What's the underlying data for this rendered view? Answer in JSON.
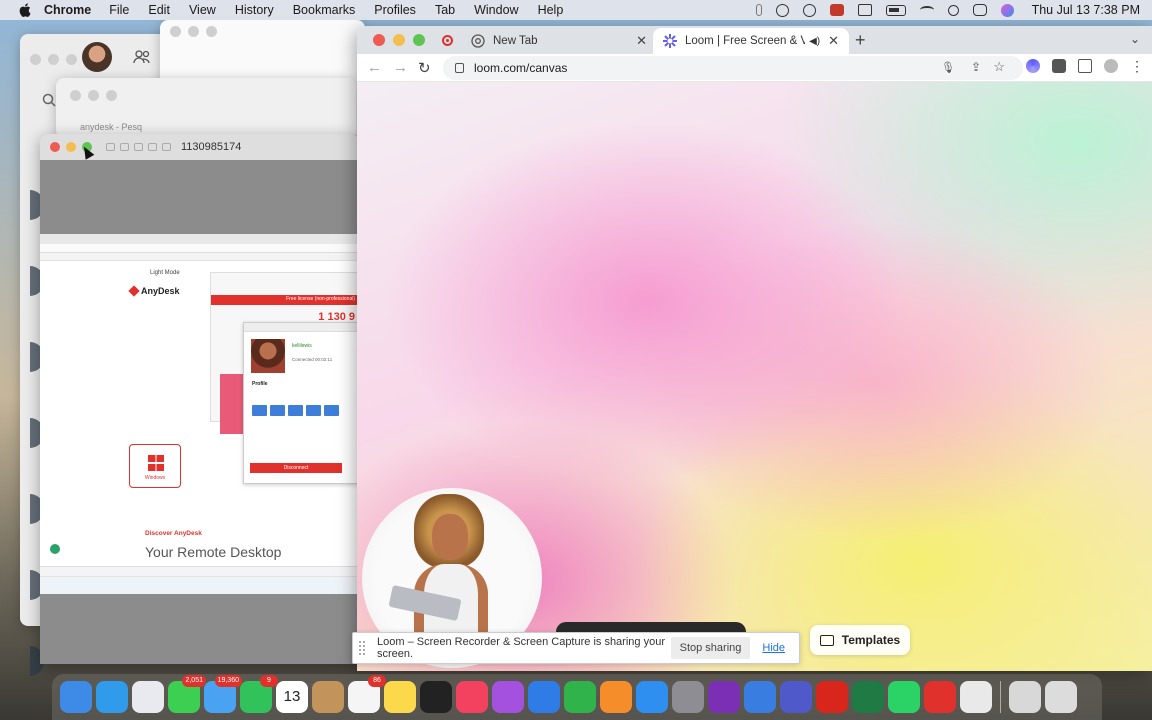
{
  "menubar": {
    "app_name": "Chrome",
    "items": [
      "File",
      "Edit",
      "View",
      "History",
      "Bookmarks",
      "Profiles",
      "Tab",
      "Window",
      "Help"
    ],
    "clock": "Thu Jul 13  7:38 PM"
  },
  "background_windows": {
    "anydesk_tab_text": "anydesk - Pesq"
  },
  "anydesk_window": {
    "title": "1130985174",
    "remote": {
      "mode_label": "Light Mode",
      "logo_text": "AnyDesk",
      "windows_label": "Windows",
      "discover_text": "Discover AnyDesk",
      "headline": "Your Remote Desktop",
      "license_banner": "Free license (non-professional)",
      "big_id": "1 130 9",
      "profile_name": "kellilewis",
      "connected_text": "Connected 00:02:11",
      "profile_heading": "Profile",
      "disconnect_label": "Disconnect"
    }
  },
  "chrome": {
    "tabs": [
      {
        "label": "New Tab",
        "icon": "chrome-icon",
        "active": false
      },
      {
        "label": "Loom | Free Screen & Vide",
        "icon": "loom-icon",
        "active": true,
        "audio": true
      }
    ],
    "url": "loom.com/canvas",
    "templates_label": "Templates",
    "share_banner": {
      "message": "Loom – Screen Recorder & Screen Capture is sharing your screen.",
      "stop_label": "Stop sharing",
      "hide_label": "Hide"
    }
  },
  "dock": {
    "apps": [
      {
        "name": "finder",
        "color": "#3d8be6"
      },
      {
        "name": "safari",
        "color": "#2f9bea"
      },
      {
        "name": "launchpad",
        "color": "#e8eaef"
      },
      {
        "name": "messages",
        "color": "#3ccf52",
        "badge": "2,051"
      },
      {
        "name": "mail",
        "color": "#4aa3f2",
        "badge": "19,360"
      },
      {
        "name": "facetime",
        "color": "#31c25b",
        "badge": "9"
      },
      {
        "name": "calendar",
        "color": "#ffffff",
        "day": "13",
        "month": "JUL 12"
      },
      {
        "name": "contacts",
        "color": "#c2945c"
      },
      {
        "name": "reminders",
        "color": "#f5f5f5",
        "badge": "86"
      },
      {
        "name": "notes",
        "color": "#fbd94a"
      },
      {
        "name": "appletv",
        "color": "#222222"
      },
      {
        "name": "music",
        "color": "#f3425f"
      },
      {
        "name": "podcasts",
        "color": "#a451e0"
      },
      {
        "name": "keynote",
        "color": "#2f7ce6"
      },
      {
        "name": "numbers",
        "color": "#2fb34a"
      },
      {
        "name": "pages",
        "color": "#f58d2b"
      },
      {
        "name": "appstore",
        "color": "#2e8ff0"
      },
      {
        "name": "systemsettings",
        "color": "#8d8d93"
      },
      {
        "name": "onenote",
        "color": "#7b2fb5"
      },
      {
        "name": "todo",
        "color": "#3a7de0"
      },
      {
        "name": "teams",
        "color": "#5059c9"
      },
      {
        "name": "acrobat",
        "color": "#d9261c"
      },
      {
        "name": "excel",
        "color": "#1f7a44"
      },
      {
        "name": "whatsapp",
        "color": "#2bd265"
      },
      {
        "name": "anydesk",
        "color": "#e0312c"
      },
      {
        "name": "chrome",
        "color": "#e9e9e9"
      },
      {
        "name": "downloads-stack",
        "color": "#d8d8d8"
      },
      {
        "name": "trash",
        "color": "#dcdcdc"
      }
    ]
  }
}
